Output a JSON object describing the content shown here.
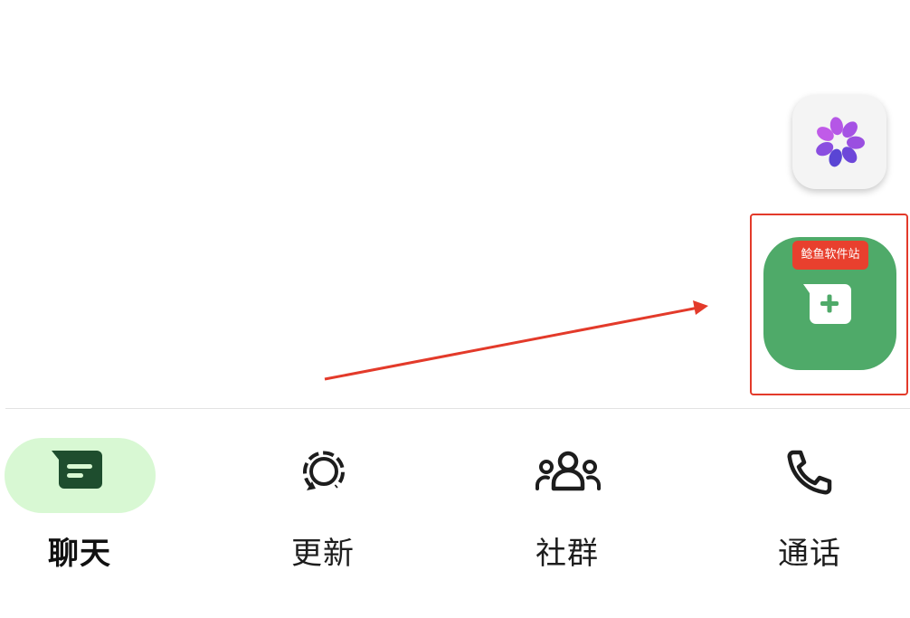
{
  "floating_actions": {
    "meta_ai_icon": "meta-ai-ring-icon",
    "new_chat_icon": "new-chat-plus-icon",
    "fab_color": "#4faa69",
    "watermark_text": "鲶鱼软件站"
  },
  "annotation": {
    "color": "#e33a2a"
  },
  "bottom_nav": {
    "active_pill_color": "#d8f8d3",
    "items": [
      {
        "label": "聊天",
        "icon": "chat-icon",
        "active": true
      },
      {
        "label": "更新",
        "icon": "updates-icon",
        "active": false
      },
      {
        "label": "社群",
        "icon": "communities-icon",
        "active": false
      },
      {
        "label": "通话",
        "icon": "phone-icon",
        "active": false
      }
    ]
  }
}
